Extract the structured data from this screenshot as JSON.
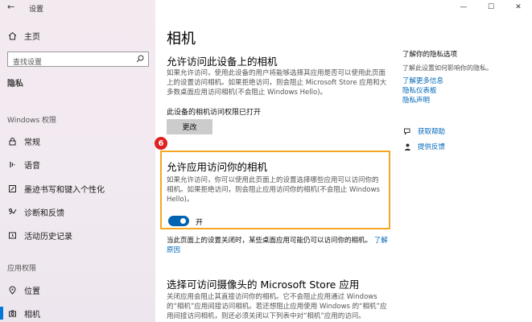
{
  "window": {
    "title": "设置",
    "minimize": "—",
    "maximize": "☐",
    "close": "✕"
  },
  "sidebar": {
    "home": "主页",
    "search_placeholder": "查找设置",
    "section": "隐私",
    "group_windows": "Windows 权限",
    "windows_items": [
      {
        "label": "常规",
        "icon": "lock-icon"
      },
      {
        "label": "语音",
        "icon": "speech-icon"
      },
      {
        "label": "墨迹书写和键入个性化",
        "icon": "pen-icon"
      },
      {
        "label": "诊断和反馈",
        "icon": "feedback-icon"
      },
      {
        "label": "活动历史记录",
        "icon": "history-icon"
      }
    ],
    "group_app": "应用权限",
    "app_items": [
      {
        "label": "位置",
        "icon": "location-icon"
      },
      {
        "label": "相机",
        "icon": "camera-icon"
      }
    ]
  },
  "main": {
    "title": "相机",
    "device_section": {
      "heading": "允许访问此设备上的相机",
      "desc": "如果允许访问，使用此设备的用户将能够选择其应用是否可以使用此页面上的设置访问相机。如果拒绝访问，则会阻止 Microsoft Store 应用和大多数桌面应用访问相机(不会阻止 Windows Hello)。",
      "status": "此设备的相机访问权限已打开",
      "change_button": "更改"
    },
    "badge": "6",
    "app_section": {
      "heading": "允许应用访问你的相机",
      "desc": "如果允许访问，你可以使用此页面上的设置选择哪些应用可以访问你的相机。如果拒绝访问，则会阻止应用访问你的相机(不会阻止 Windows Hello)。",
      "toggle_state": "开"
    },
    "note_text": "当此页面上的设置关闭时，某些桌面应用可能仍可以访问你的相机。",
    "note_link": "了解原因",
    "store_section": {
      "heading": "选择可访问摄像头的 Microsoft Store 应用",
      "desc": "关闭应用会阻止其直接访问你的相机。它不会阻止应用通过 Windows 的“相机”应用间接访问相机。若还想阻止应用使用 Windows 的“相机”应用间接访问相机，则还必须关闭以下列表中对“相机”应用的访问。"
    }
  },
  "right": {
    "title": "了解你的隐私选项",
    "desc": "了解此设置如何影响你的隐私。",
    "links": [
      "了解更多信息",
      "隐私仪表板",
      "隐私声明"
    ],
    "get_help": "获取帮助",
    "give_feedback": "提供反馈"
  },
  "colors": {
    "accent": "#0078d7",
    "highlight_border": "#f5a623",
    "badge": "#e02020"
  }
}
